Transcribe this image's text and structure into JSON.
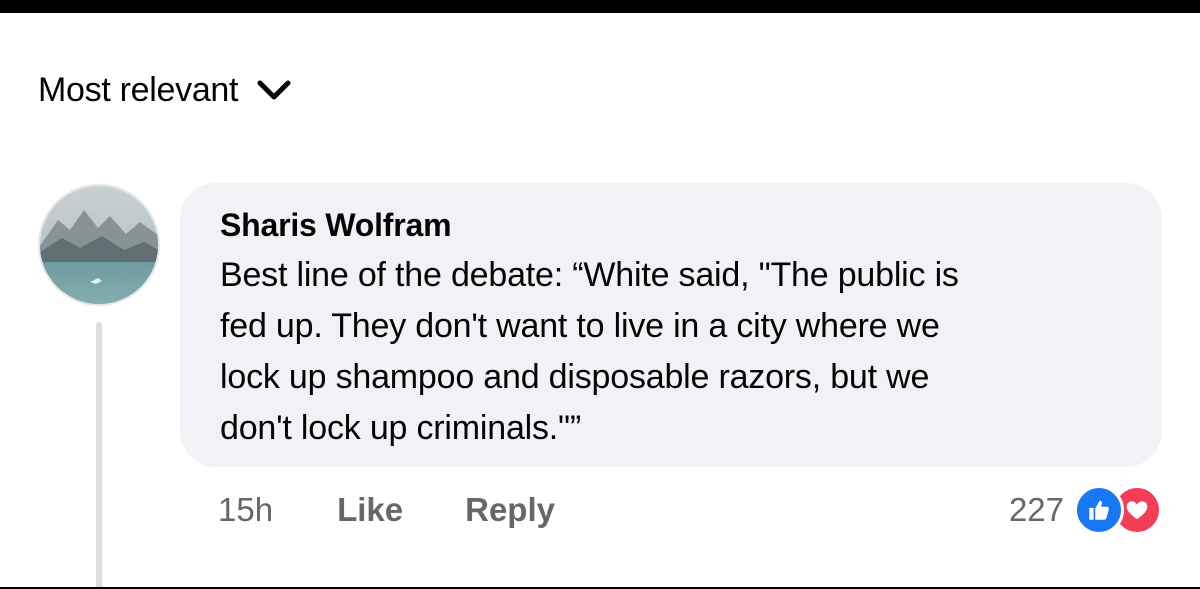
{
  "sort": {
    "label": "Most relevant"
  },
  "comment": {
    "author": "Sharis Wolfram",
    "text": "Best line of the debate: “White said, \"The public is\nfed up. They don't want to live in a city where we\nlock up shampoo and disposable razors, but we\ndon't lock up criminals.\"”",
    "time": "15h",
    "like_label": "Like",
    "reply_label": "Reply",
    "reaction_count": "227",
    "reactions": [
      "like-icon",
      "love-icon"
    ]
  },
  "colors": {
    "bubble": "#f0f2f5",
    "meta_text": "#65676b",
    "like_blue": "#1877f2",
    "love_red": "#f33e58"
  }
}
